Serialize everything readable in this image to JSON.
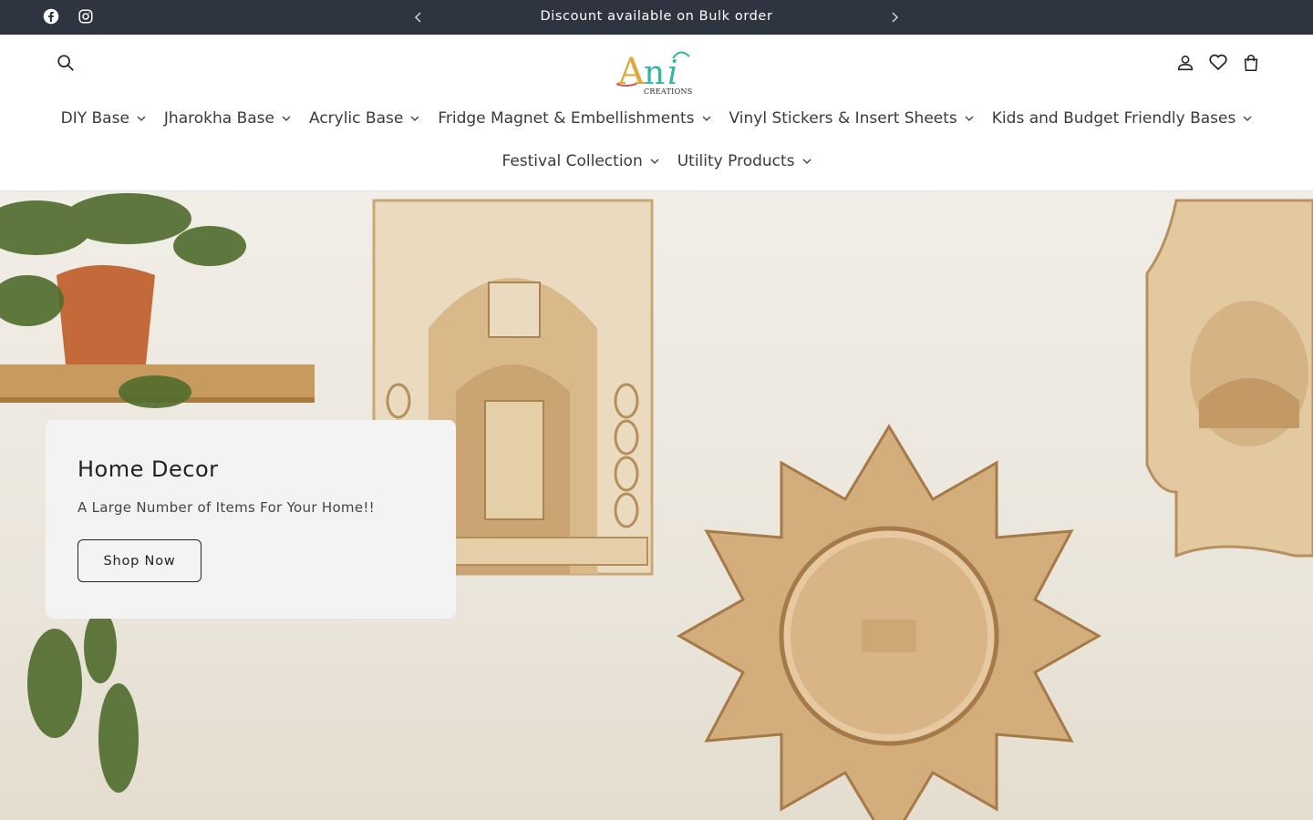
{
  "announcement": {
    "message": "Discount available on Bulk order",
    "prev_icon": "chevron-left-icon",
    "next_icon": "chevron-right-icon"
  },
  "social": {
    "items": [
      {
        "icon": "facebook-icon"
      },
      {
        "icon": "instagram-icon"
      }
    ]
  },
  "header": {
    "logo_mark": "Ani",
    "logo_sub": "CREATIONS",
    "icons": [
      "search-icon",
      "account-icon",
      "heart-icon",
      "cart-icon"
    ]
  },
  "nav": {
    "row1": [
      {
        "label": "DIY Base"
      },
      {
        "label": "Jharokha Base"
      },
      {
        "label": "Acrylic Base"
      },
      {
        "label": "Fridge Magnet & Embellishments"
      },
      {
        "label": "Vinyl Stickers & Insert Sheets"
      },
      {
        "label": "Kids and Budget Friendly Bases"
      }
    ],
    "row2": [
      {
        "label": "Festival Collection"
      },
      {
        "label": "Utility Products"
      }
    ]
  },
  "hero": {
    "title": "Home Decor",
    "description": "A Large Number of Items For Your Home!!",
    "button_label": "Shop Now"
  },
  "colors": {
    "announcement_bg": "#2f3441",
    "text": "#2b2b2b",
    "card_bg": "#f3f3f3",
    "logo_gold": "#e0a83a",
    "logo_teal": "#2fb7a3"
  }
}
